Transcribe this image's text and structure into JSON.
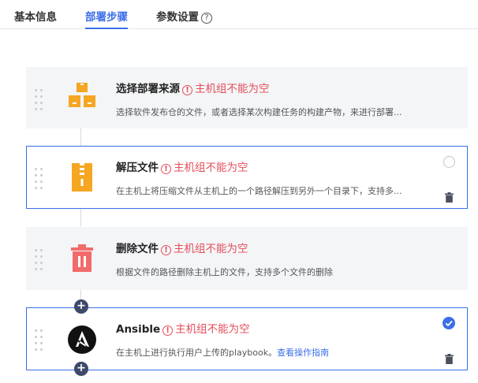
{
  "tabs": {
    "basic": "基本信息",
    "steps": "部署步骤",
    "params": "参数设置",
    "help": "?"
  },
  "error_icon": "!",
  "add_label": "+",
  "colors": {
    "accent": "#3b6ee8",
    "error": "#e34d59",
    "source_icon": "#f5a623",
    "delete_icon": "#f26b6b"
  },
  "steps": [
    {
      "title": "选择部署来源",
      "error": "主机组不能为空",
      "desc": "选择软件发布仓的文件，或者选择某次构建任务的构建产物，来进行部署...",
      "icon": "boxes-icon",
      "selected": false
    },
    {
      "title": "解压文件",
      "error": "主机组不能为空",
      "desc": "在主机上将压缩文件从主机上的一个路径解压到另外一个目录下，支持多...",
      "icon": "zip-file-icon",
      "selected": true,
      "checked": false
    },
    {
      "title": "删除文件",
      "error": "主机组不能为空",
      "desc": "根据文件的路径删除主机上的文件，支持多个文件的删除",
      "icon": "trash-red-icon",
      "selected": false
    },
    {
      "title": "Ansible",
      "error": "主机组不能为空",
      "desc": "在主机上进行执行用户上传的playbook。",
      "link": "查看操作指南",
      "icon": "ansible-icon",
      "selected": true,
      "checked": true
    }
  ]
}
